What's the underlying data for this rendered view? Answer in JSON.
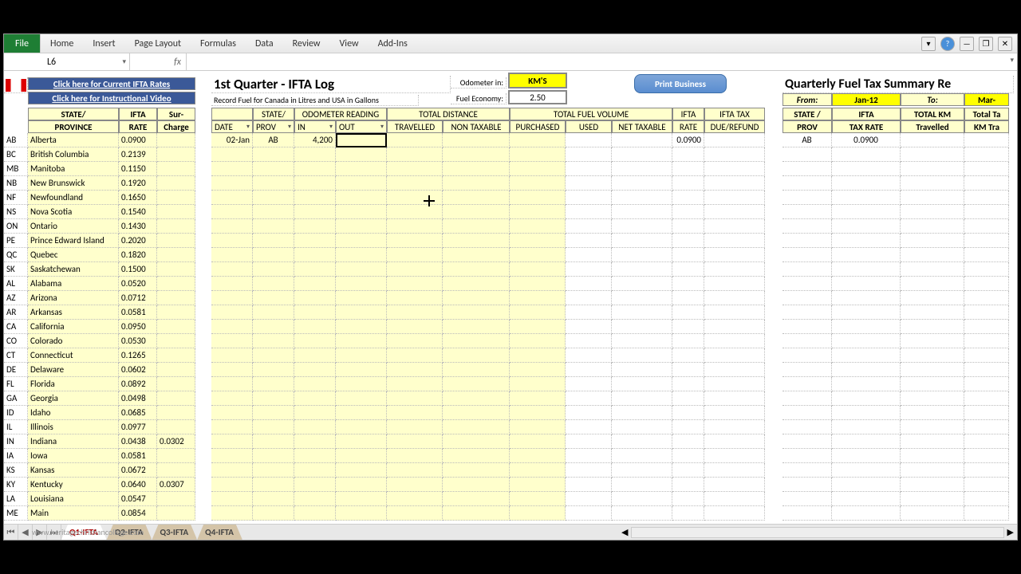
{
  "ribbon": {
    "file": "File",
    "tabs": [
      "Home",
      "Insert",
      "Page Layout",
      "Formulas",
      "Data",
      "Review",
      "View",
      "Add-Ins"
    ]
  },
  "namebox": "L6",
  "fx": "fx",
  "links": {
    "rates": "Click here for Current IFTA Rates",
    "video": "Click here for Instructional Video"
  },
  "left_headers": {
    "state": "STATE/",
    "prov": "PROVINCE",
    "ifta": "IFTA",
    "rate": "RATE",
    "sur": "Sur-",
    "charge": "Charge"
  },
  "provinces": [
    {
      "c": "AB",
      "n": "Alberta",
      "r": "0.0900"
    },
    {
      "c": "BC",
      "n": "British Columbia",
      "r": "0.2139"
    },
    {
      "c": "MB",
      "n": "Manitoba",
      "r": "0.1150"
    },
    {
      "c": "NB",
      "n": "New Brunswick",
      "r": "0.1920"
    },
    {
      "c": "NF",
      "n": "Newfoundland",
      "r": "0.1650"
    },
    {
      "c": "NS",
      "n": "Nova Scotia",
      "r": "0.1540"
    },
    {
      "c": "ON",
      "n": "Ontario",
      "r": "0.1430"
    },
    {
      "c": "PE",
      "n": "Prince Edward Island",
      "r": "0.2020"
    },
    {
      "c": "QC",
      "n": "Quebec",
      "r": "0.1820"
    },
    {
      "c": "SK",
      "n": "Saskatchewan",
      "r": "0.1500"
    },
    {
      "c": "AL",
      "n": "Alabama",
      "r": "0.0520"
    },
    {
      "c": "AZ",
      "n": "Arizona",
      "r": "0.0712"
    },
    {
      "c": "AR",
      "n": "Arkansas",
      "r": "0.0581"
    },
    {
      "c": "CA",
      "n": "California",
      "r": "0.0950"
    },
    {
      "c": "CO",
      "n": "Colorado",
      "r": "0.0530"
    },
    {
      "c": "CT",
      "n": "Connecticut",
      "r": "0.1265"
    },
    {
      "c": "DE",
      "n": "Delaware",
      "r": "0.0602"
    },
    {
      "c": "FL",
      "n": "Florida",
      "r": "0.0892"
    },
    {
      "c": "GA",
      "n": "Georgia",
      "r": "0.0498"
    },
    {
      "c": "ID",
      "n": "Idaho",
      "r": "0.0685"
    },
    {
      "c": "IL",
      "n": "Illinois",
      "r": "0.0977"
    },
    {
      "c": "IN",
      "n": "Indiana",
      "r": "0.0438",
      "s": "0.0302"
    },
    {
      "c": "IA",
      "n": "Iowa",
      "r": "0.0581"
    },
    {
      "c": "KS",
      "n": "Kansas",
      "r": "0.0672"
    },
    {
      "c": "KY",
      "n": "Kentucky",
      "r": "0.0640",
      "s": "0.0307"
    },
    {
      "c": "LA",
      "n": "Louisiana",
      "r": "0.0547"
    },
    {
      "c": "ME",
      "n": "Main",
      "r": "0.0854"
    }
  ],
  "main": {
    "title": "1st Quarter - IFTA Log",
    "subtitle": "Record Fuel for Canada in Litres and USA in Gallons",
    "odo_lbl": "Odometer in:",
    "odo_val": "KM'S",
    "fe_lbl": "Fuel Economy:",
    "fe_val": "2.50",
    "print": "Print Business",
    "hdrs": {
      "state": "STATE/",
      "odo": "ODOMETER READING",
      "td": "TOTAL DISTANCE",
      "tfv": "TOTAL FUEL VOLUME",
      "ifta": "IFTA",
      "tax": "IFTA TAX",
      "date": "DATE",
      "prov": "PROV",
      "in": "IN",
      "out": "OUT",
      "trav": "TRAVELLED",
      "nt": "NON TAXABLE",
      "pur": "PURCHASED",
      "used": "USED",
      "net": "NET TAXABLE",
      "rate": "RATE",
      "due": "DUE/REFUND"
    },
    "row": {
      "date": "02-Jan",
      "prov": "AB",
      "in": "4,200",
      "rate": "0.0900"
    }
  },
  "right": {
    "title": "Quarterly Fuel Tax Summary Re",
    "from": "From:",
    "from_v": "Jan-12",
    "to": "To:",
    "to_v": "Mar-",
    "h": {
      "sp": "STATE /",
      "pr": "PROV",
      "ifta": "IFTA",
      "tr": "TAX RATE",
      "tk": "TOTAL KM",
      "trav": "Travelled",
      "tt": "Total Ta",
      "kt": "KM Tra"
    },
    "row": {
      "prov": "AB",
      "rate": "0.0900"
    }
  },
  "sheets": [
    "Q1-IFTA",
    "Q2-IFTA",
    "Q3-IFTA",
    "Q4-IFTA"
  ],
  "watermark": "www.heritagechristiancollege.com"
}
